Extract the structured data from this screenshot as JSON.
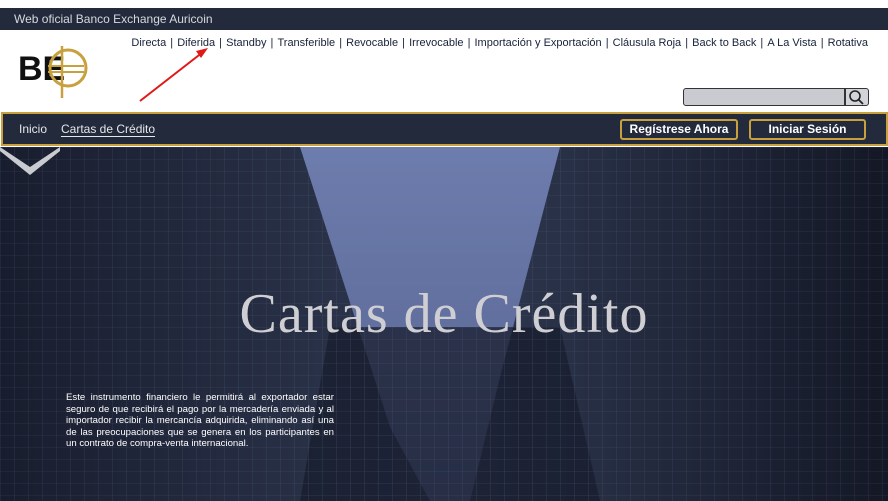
{
  "topbar": {
    "title": "Web oficial Banco Exchange Auricoin"
  },
  "logo": {
    "text": "BE"
  },
  "quick_links": [
    "Directa",
    "Diferida",
    "Standby",
    "Transferible",
    "Revocable",
    "Irrevocable",
    "Importación y Exportación",
    "Cláusula Roja",
    "Back to Back",
    "A La Vista",
    "Rotativa"
  ],
  "search": {
    "placeholder": "",
    "value": ""
  },
  "nav": {
    "items": [
      "Inicio",
      "Cartas de Crédito"
    ],
    "register_label": "Regístrese Ahora",
    "login_label": "Iniciar Sesión"
  },
  "hero": {
    "title": "Cartas de Crédito",
    "description": "Este instrumento financiero le permitirá al exportador estar seguro de que recibirá el pago por la mercadería enviada y al importador recibir la mercancía adquirida, eliminando así una de las preocupaciones que se genera en los participantes en un contrato de compra-venta internacional."
  },
  "colors": {
    "navy": "#232a3b",
    "gold": "#c8a13e",
    "sky": "#7f93cf"
  },
  "icons": {
    "search": "search-icon",
    "scroll": "chevron-down-icon",
    "annotation": "red-arrow-icon"
  }
}
